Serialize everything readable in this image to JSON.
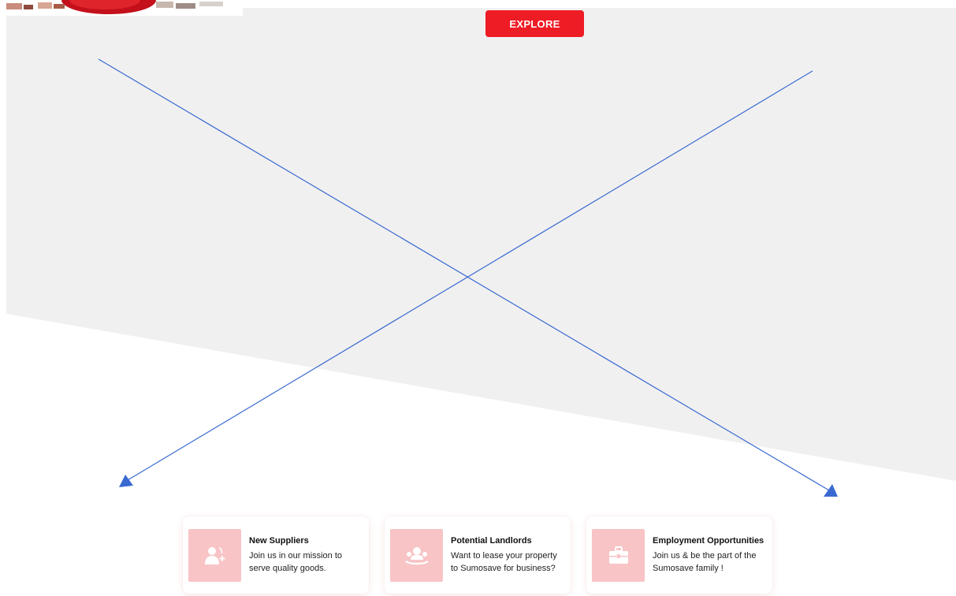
{
  "explore_button": {
    "label": "EXPLORE"
  },
  "cards": [
    {
      "title": "New Suppliers",
      "description": "Join us in our mission to serve quality goods.",
      "icon": "add-user-icon"
    },
    {
      "title": "Potential Landlords",
      "description": "Want to lease your property to Sumosave for business?",
      "icon": "handshake-person-icon"
    },
    {
      "title": "Employment Opportunities",
      "description": "Join us & be the part of the Sumosave family !",
      "icon": "briefcase-icon"
    }
  ],
  "colors": {
    "accent": "#ee1c25",
    "tile": "#f8c4c6",
    "background_shape": "#f1f0f1",
    "annotation": "#3a6ad1"
  }
}
